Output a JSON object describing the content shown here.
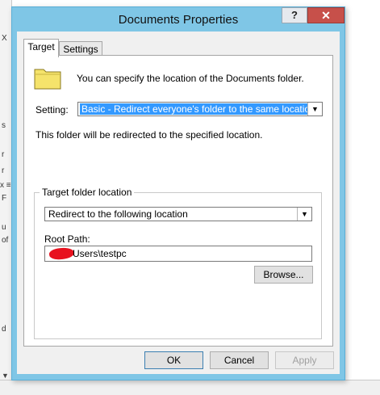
{
  "dialog": {
    "title": "Documents Properties",
    "help_label": "?",
    "close_label": "✕"
  },
  "tabs": [
    {
      "label": "Target",
      "active": true
    },
    {
      "label": "Settings",
      "active": false
    }
  ],
  "target": {
    "intro_text": "You can specify the location of the Documents folder.",
    "setting_label": "Setting:",
    "setting_value": "Basic - Redirect everyone's folder to the same location",
    "redirect_text": "This folder will be redirected to the specified location.",
    "group_title": "Target folder location",
    "location_value": "Redirect to the following location",
    "root_path_label": "Root Path:",
    "root_path_value": "Users\\testpc",
    "browse_label": "Browse..."
  },
  "footer": {
    "ok_label": "OK",
    "cancel_label": "Cancel",
    "apply_label": "Apply"
  },
  "background": {
    "fragments": [
      "X",
      "s",
      "r",
      "r",
      "x ≡",
      "F",
      "u",
      "of",
      "d"
    ]
  },
  "colors": {
    "title_bar": "#7fc6e6",
    "close_button": "#c7504a",
    "selection": "#3399ff",
    "folder_icon": "#f5e36b"
  }
}
